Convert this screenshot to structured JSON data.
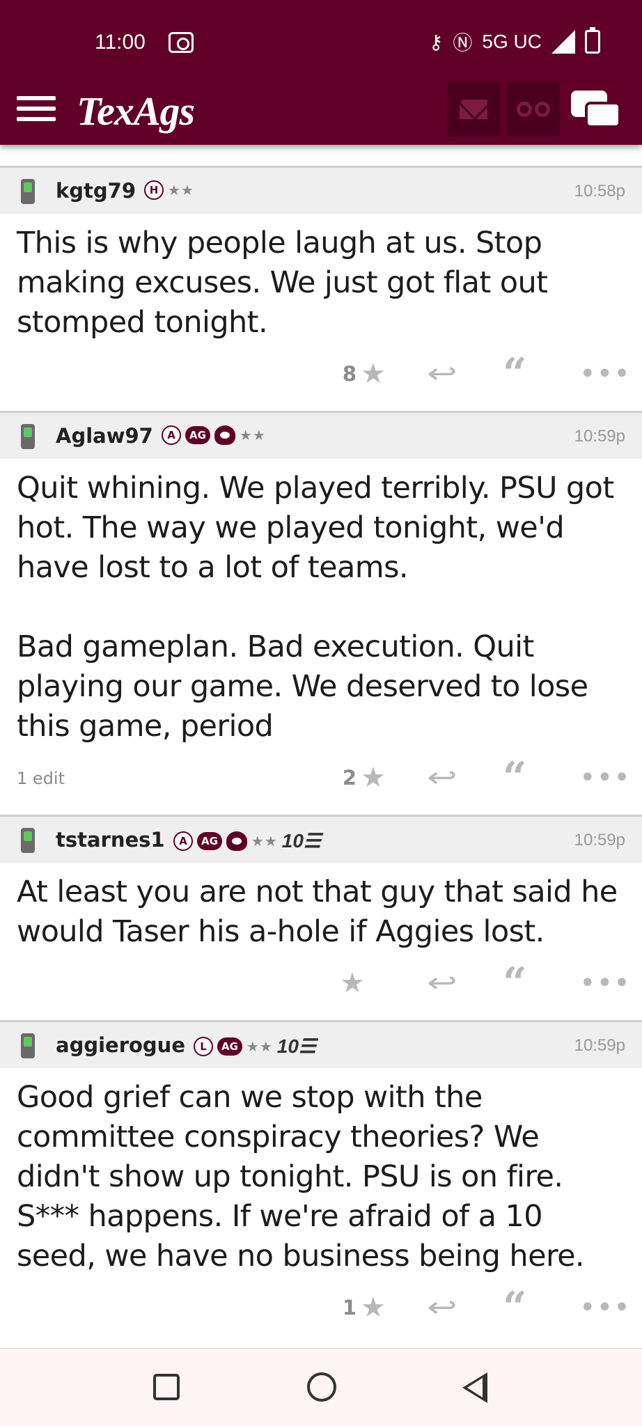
{
  "status_bar": {
    "time": "11:00",
    "network": "5G UC"
  },
  "header": {
    "logo_text": "TexAgs"
  },
  "posts": [
    {
      "username": "kgtg79",
      "badge_letter": "H",
      "has_ag": false,
      "has_helmet": false,
      "has_10": false,
      "stars": "★★",
      "time": "10:58p",
      "body": "This is why people laugh at us. Stop making excuses. We just got flat out stomped tonight.",
      "edits": "",
      "star_count": "8"
    },
    {
      "username": "Aglaw97",
      "badge_letter": "A",
      "has_ag": true,
      "has_helmet": true,
      "has_10": false,
      "stars": "★★",
      "time": "10:59p",
      "body": "Quit whining. We played terribly. PSU got hot. The way we played tonight, we'd have lost to a lot of teams.\n\nBad gameplan. Bad execution. Quit playing our game. We deserved to lose this game, period",
      "edits": "1 edit",
      "star_count": "2"
    },
    {
      "username": "tstarnes1",
      "badge_letter": "A",
      "has_ag": true,
      "has_helmet": true,
      "has_10": true,
      "stars": "★★",
      "time": "10:59p",
      "body": "At least you are not that guy that said he would Taser his a-hole if Aggies lost.",
      "edits": "",
      "star_count": ""
    },
    {
      "username": "aggierogue",
      "badge_letter": "L",
      "has_ag": true,
      "has_helmet": false,
      "has_10": true,
      "stars": "★★",
      "time": "10:59p",
      "body": "Good grief can we stop with the committee conspiracy theories? We didn't show up tonight. PSU is on fire. S*** happens. If we're afraid of a 10 seed, we have no business being here.",
      "edits": "",
      "star_count": "1"
    }
  ],
  "labels": {
    "ag": "AG",
    "ten": "10☰"
  }
}
